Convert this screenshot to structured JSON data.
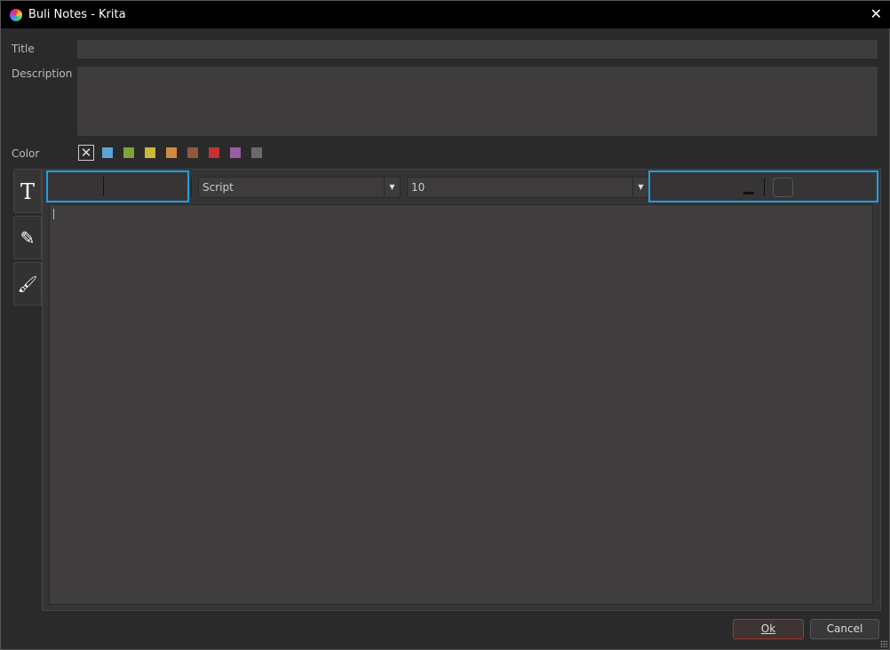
{
  "window": {
    "title": "Buli Notes - Krita",
    "close": "✕"
  },
  "form": {
    "title_label": "Title",
    "title_value": "",
    "description_label": "Description",
    "description_value": "",
    "color_label": "Color"
  },
  "colors": [
    "#5ba4d4",
    "#7fa23b",
    "#c9b839",
    "#d28b3d",
    "#8e5a3f",
    "#c33332",
    "#9b5ba8",
    "#6a6a6a"
  ],
  "tabs": [
    {
      "icon": "T"
    },
    {
      "icon": "✎"
    },
    {
      "icon": "🖌"
    }
  ],
  "toolbar": {
    "font": "Script",
    "size": "10"
  },
  "buttons": {
    "ok": "Ok",
    "cancel": "Cancel"
  }
}
